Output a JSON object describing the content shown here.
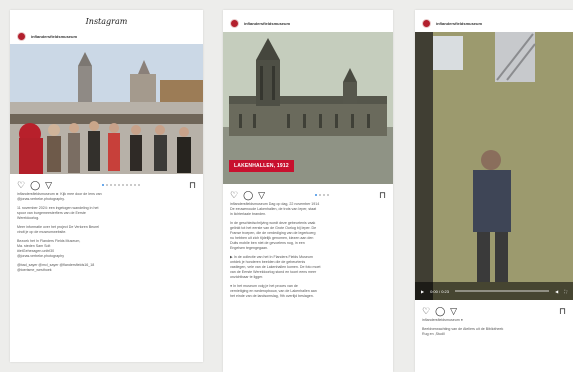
{
  "card1": {
    "brand": "Instagram",
    "username": "inflandersfieldsmuseum",
    "caption": [
      "inflandersfieldsmuseum ► Kijk mee door de lens van",
      "@jonas.verbeke.photography.",
      "",
      "11 november 2024: een ingetogen wandeling in het",
      "spoor van burgemeesterfiers van de Eerste",
      "Wereldoorlog.",
      "",
      "Meer informatie over het project De Verloren Beurel",
      "vindt je op de museumwebsite.",
      "",
      "Bezoek het In Flanders Fields Museum,",
      "Ma. steden Sam Solt",
      "#ietGehexagen.unitrl30",
      "@jonas.verbeke.photography",
      "",
      "@bad_sayer @mcl_sayer @flandersfields16_18",
      "@toerisme_westhoek"
    ]
  },
  "card2": {
    "username": "inflandersfieldsmuseum",
    "label": "LAKENHALLEN, 1912",
    "caption": [
      "inflandersfieldsmuseum Dag op dag, 22 november 1914",
      "De eeuwenoude Lakenhallen, de trots van Ieper, staat",
      "in lichterlaaie branden.",
      "",
      "In de geschiedschrijving wordt deze gebeurtenis vaak",
      "gelinkt tot het eerste van de Grote Oorlog bij Ieper. De",
      "Franse troepen, die de verdediging van de legerkoerg",
      "nu hebben uit zich tijdelijk genomen, kiezen aan den",
      "Duits mobile ben niet de gevoelens nog, in een",
      "Engelsen tegengegaan.",
      "",
      "▶ In de collectie van het In Flanders Fields Museum",
      "ontdek je honderen beelden die de gebeurtenis",
      "vastlegen, vele van de Lakenhallen komen. De foto moet",
      "van de Eerste Wereldoorlog stond en toont eens meer",
      "onzichtbaar te ligger.",
      "",
      "● In het museum volg je het proces van de",
      "vernietiging en wederopbouw, van de Lakenhallen aan",
      "het einde van de landsomslag, 9th overlijd beslagen."
    ]
  },
  "card3": {
    "username": "inflandersfieldsmuseum",
    "video_time": "0:00 / 0:23",
    "caption": [
      "inflandersfieldsmuseum ●",
      "",
      "Beeldverwachting van de Ateliers uit de Bibliotheek",
      "Rug en ,Studll"
    ]
  }
}
